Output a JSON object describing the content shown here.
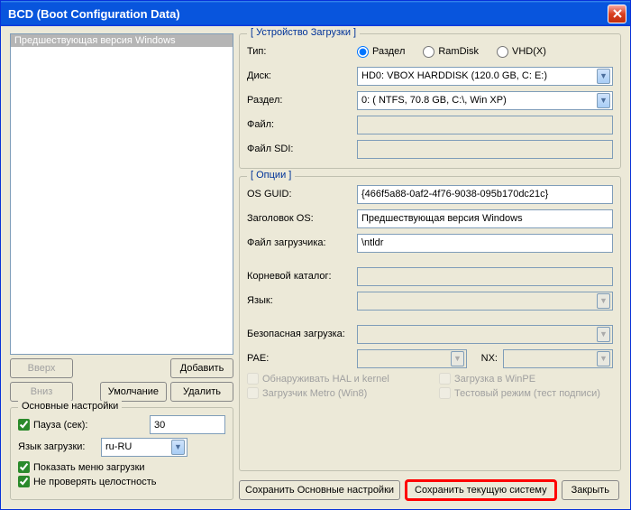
{
  "title": "BCD (Boot Configuration Data)",
  "list": {
    "item": "Предшествующая версия Windows"
  },
  "leftButtons": {
    "up": "Вверх",
    "add": "Добавить",
    "down": "Вниз",
    "default": "Умолчание",
    "delete": "Удалить"
  },
  "mainSettings": {
    "title": "Основные настройки",
    "pause_label": "Пауза (сек):",
    "pause_value": "30",
    "lang_label": "Язык загрузки:",
    "lang_value": "ru-RU",
    "show_menu": "Показать меню загрузки",
    "no_integrity": "Не проверять целостность"
  },
  "bootDevice": {
    "title": "[ Устройство Загрузки ]",
    "type_label": "Тип:",
    "type_partition": "Раздел",
    "type_ramdisk": "RamDisk",
    "type_vhd": "VHD(X)",
    "disk_label": "Диск:",
    "disk_value": "HD0: VBOX HARDDISK (120.0 GB, C: E:)",
    "partition_label": "Раздел:",
    "partition_value": "0: ( NTFS,  70.8 GB, C:\\, Win XP)",
    "file_label": "Файл:",
    "sdi_label": "Файл SDI:"
  },
  "options": {
    "title": "[ Опции ]",
    "guid_label": "OS GUID:",
    "guid_value": "{466f5a88-0af2-4f76-9038-095b170dc21c}",
    "ostitle_label": "Заголовок OS:",
    "ostitle_value": "Предшествующая версия Windows",
    "loader_label": "Файл загрузчика:",
    "loader_value": "\\ntldr",
    "root_label": "Корневой каталог:",
    "lang_label": "Язык:",
    "safe_label": "Безопасная загрузка:",
    "pae_label": "PAE:",
    "nx_label": "NX:",
    "hal": "Обнаруживать HAL и kernel",
    "winpe": "Загрузка в WinPE",
    "metro": "Загрузчик Metro (Win8)",
    "testmode": "Тестовый режим (тест подписи)"
  },
  "bottom": {
    "save_main": "Сохранить Основные настройки",
    "save_current": "Сохранить текущую систему",
    "close": "Закрыть"
  }
}
